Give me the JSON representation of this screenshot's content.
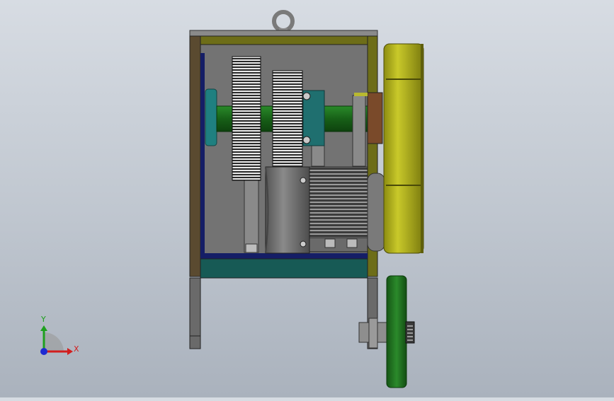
{
  "viewport": {
    "background_top": "#d7dce3",
    "background_bottom": "#aab2bd"
  },
  "model": {
    "frame_color": "#6d6d18",
    "housing_color": "#6e6e6e",
    "shaft_color": "#1e6b1e",
    "base_color": "#175a55",
    "flywheel_color": "#b8b820",
    "pulley_color": "#1f6d1f",
    "motor_color": "#6f6f6f",
    "icons": [
      "lifting-eye-icon",
      "gear-icon",
      "motor-icon",
      "flywheel-icon",
      "pulley-icon"
    ]
  },
  "triad": {
    "x_label": "X",
    "y_label": "Y",
    "x_color": "#d21e1e",
    "y_color": "#1ea01e",
    "z_color": "#1e2ad2"
  }
}
